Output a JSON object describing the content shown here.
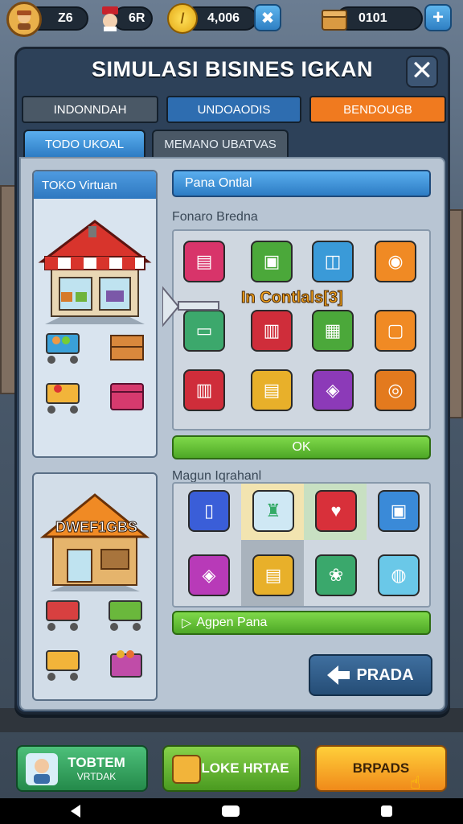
{
  "hud": {
    "stat1_value": "Z6",
    "stat2_value": "6R",
    "coins_value": "4,006",
    "coins_icon": "coin-icon",
    "crates_value": "0101",
    "crates_icon": "crate-icon"
  },
  "panel": {
    "title": "SIMULASI BISINES IGKAN",
    "close_label": "✕",
    "category_tabs": [
      "INDONNDAH",
      "UNDOAODIS",
      "BENDOUGB"
    ],
    "sub_tabs": [
      "TODO UKOAL",
      "MEMANO UBATVAS"
    ]
  },
  "left": {
    "card1_title": "TOKO Virtuan",
    "card2_shop_sign": "DWEF1GBS"
  },
  "right": {
    "section1_bar": "Pana Ontlal",
    "section1_label": "Fonaro Bredna",
    "overlay_text": "In Contlals[3]",
    "ok_label": "OK",
    "section2_label": "Magun Iqrahanl",
    "section2_bar": "Agpen Pana",
    "back_label": "PRADA",
    "back_icon": "arrow-left-icon"
  },
  "bottom": {
    "btn1_line1": "TOBTEM",
    "btn1_line2": "VRTDAK",
    "btn2_label": "LOKE HRTAE",
    "btn3_label": "BRPADS"
  },
  "colors": {
    "accent_blue": "#2e78c0",
    "accent_orange": "#f07a1f",
    "accent_green": "#4ea826"
  }
}
